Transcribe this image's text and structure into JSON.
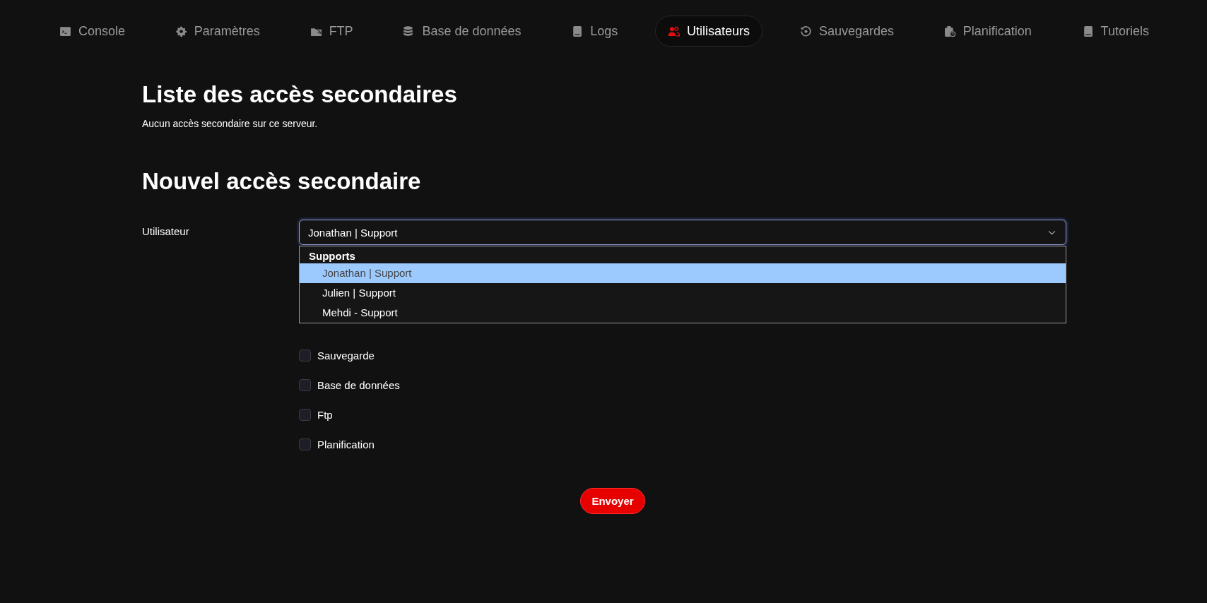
{
  "nav": {
    "tabs": [
      {
        "label": "Console",
        "selected": false
      },
      {
        "label": "Paramètres",
        "selected": false
      },
      {
        "label": "FTP",
        "selected": false
      },
      {
        "label": "Base de données",
        "selected": false
      },
      {
        "label": "Logs",
        "selected": false
      },
      {
        "label": "Utilisateurs",
        "selected": true
      },
      {
        "label": "Sauvegardes",
        "selected": false
      },
      {
        "label": "Planification",
        "selected": false
      },
      {
        "label": "Tutoriels",
        "selected": false
      }
    ]
  },
  "list_section": {
    "title": "Liste des accès secondaires",
    "message": "Aucun accès secondaire sur ce serveur."
  },
  "form": {
    "title": "Nouvel accès secondaire",
    "user_label": "Utilisateur",
    "user_select": {
      "value": "Jonathan | Support",
      "expanded": true,
      "dropdown": {
        "group": "Supports",
        "options": [
          {
            "label": "Jonathan | Support",
            "selected": true
          },
          {
            "label": "Julien | Support",
            "selected": false
          },
          {
            "label": "Mehdi - Support",
            "selected": false
          }
        ]
      }
    },
    "permissions": [
      {
        "label": "Sauvegarde",
        "checked": false
      },
      {
        "label": "Base de données",
        "checked": false
      },
      {
        "label": "Ftp",
        "checked": false
      },
      {
        "label": "Planification",
        "checked": false
      }
    ],
    "submit": "Envoyer"
  }
}
